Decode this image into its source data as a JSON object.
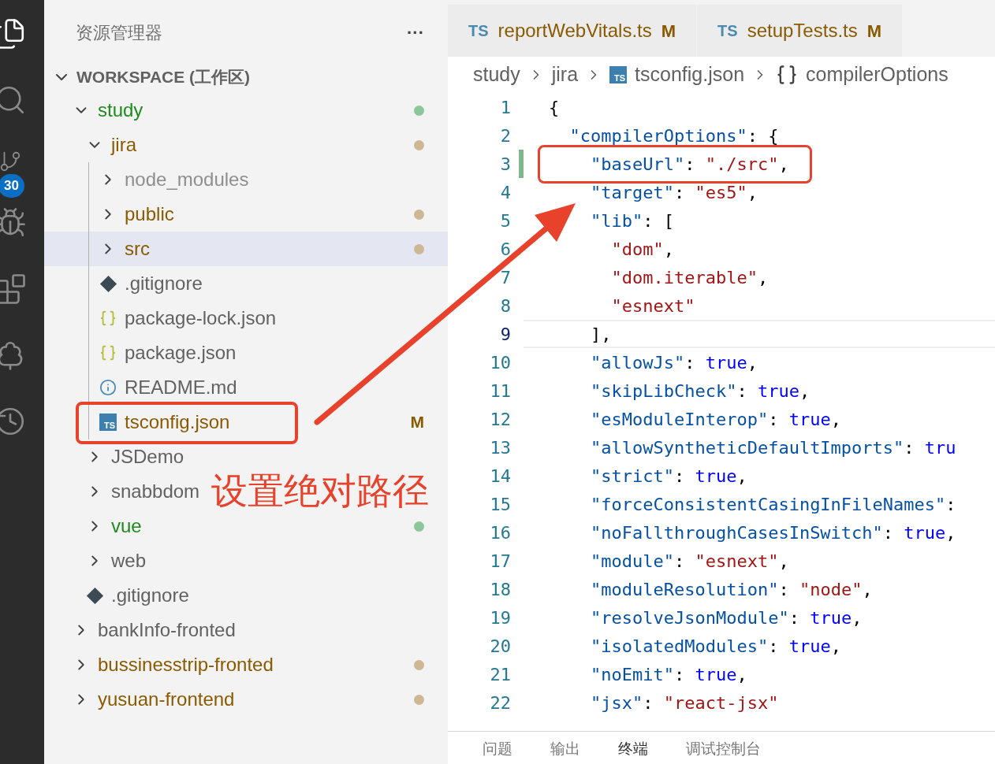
{
  "activity_bar": [
    {
      "kind": "files",
      "selected": true
    },
    {
      "kind": "search",
      "selected": false
    },
    {
      "kind": "source-control",
      "selected": false,
      "badge": "30"
    },
    {
      "kind": "run",
      "selected": false
    },
    {
      "kind": "extensions",
      "selected": false
    },
    {
      "kind": "tree",
      "selected": false
    },
    {
      "kind": "timeline",
      "selected": false
    }
  ],
  "sidebar": {
    "title": "资源管理器",
    "more": "···",
    "section": {
      "label": "WORKSPACE (工作区)",
      "expanded": true
    },
    "tree": [
      {
        "kind": "folder",
        "name": "study",
        "untracked": true,
        "ignored": false,
        "color": "#8cc69a",
        "expanded": true,
        "selected": false,
        "children": [
          {
            "kind": "folder",
            "name": "jira",
            "untracked": false,
            "ignored": false,
            "color": "#cdb893",
            "expanded": true,
            "selected": false,
            "children": [
              {
                "kind": "folder",
                "name": "node_modules",
                "untracked": false,
                "ignored": true,
                "expanded": false,
                "selected": false
              },
              {
                "kind": "folder",
                "name": "public",
                "untracked": false,
                "ignored": false,
                "color": "#cdb893",
                "expanded": false,
                "selected": false
              },
              {
                "kind": "folder",
                "name": "src",
                "untracked": false,
                "ignored": false,
                "color": "#cdb893",
                "expanded": false,
                "selected": true
              },
              {
                "kind": "git",
                "name": ".gitignore",
                "untracked": false,
                "ignored": false,
                "selected": false
              },
              {
                "kind": "json",
                "name": "package-lock.json",
                "untracked": false,
                "ignored": false,
                "selected": false
              },
              {
                "kind": "json",
                "name": "package.json",
                "untracked": false,
                "ignored": false,
                "selected": false
              },
              {
                "kind": "info",
                "name": "README.md",
                "untracked": false,
                "ignored": false,
                "selected": false
              },
              {
                "kind": "ts",
                "name": "tsconfig.json",
                "untracked": false,
                "ignored": false,
                "badge": "M",
                "icon_label": "TS",
                "selected": false
              }
            ]
          },
          {
            "kind": "folder",
            "name": "JSDemo",
            "untracked": false,
            "ignored": false,
            "expanded": false,
            "selected": false
          },
          {
            "kind": "folder",
            "name": "snabbdom",
            "untracked": false,
            "ignored": false,
            "expanded": false,
            "selected": false
          },
          {
            "kind": "folder",
            "name": "vue",
            "untracked": true,
            "ignored": false,
            "color": "#8cc69a",
            "expanded": false,
            "selected": false
          },
          {
            "kind": "folder",
            "name": "web",
            "untracked": false,
            "ignored": false,
            "expanded": false,
            "selected": false
          },
          {
            "kind": "git",
            "name": ".gitignore",
            "untracked": false,
            "ignored": false,
            "selected": false
          }
        ]
      },
      {
        "kind": "folder",
        "name": "bankInfo-fronted",
        "untracked": false,
        "ignored": false,
        "expanded": false,
        "selected": false
      },
      {
        "kind": "folder",
        "name": "bussinesstrip-fronted",
        "untracked": false,
        "ignored": false,
        "color": "#cdb893",
        "expanded": false,
        "selected": false
      },
      {
        "kind": "folder",
        "name": "yusuan-frontend",
        "untracked": false,
        "ignored": false,
        "color": "#cdb893",
        "expanded": false,
        "selected": false
      }
    ]
  },
  "editor": {
    "tabs": [
      {
        "icon_label": "TS",
        "label": "reportWebVitals.ts",
        "badge": "M",
        "selected": false
      },
      {
        "icon_label": "TS",
        "label": "setupTests.ts",
        "badge": "M",
        "selected": false
      }
    ],
    "breadcrumb": [
      {
        "kind": "folder",
        "label": "study"
      },
      {
        "kind": "folder",
        "label": "jira"
      },
      {
        "kind": "ts",
        "icon_label": "TS",
        "label": "tsconfig.json"
      },
      {
        "kind": "object",
        "label": "compilerOptions"
      }
    ],
    "lines": [
      {
        "number": "1",
        "current": false,
        "modified": false,
        "tokens": [
          {
            "kind": "punct",
            "text": "{"
          }
        ]
      },
      {
        "number": "2",
        "current": false,
        "modified": false,
        "tokens": [
          {
            "kind": "key",
            "text": "  \"compilerOptions\""
          },
          {
            "kind": "punct",
            "text": ": {"
          }
        ]
      },
      {
        "number": "3",
        "current": false,
        "modified": true,
        "tokens": [
          {
            "kind": "key",
            "text": "    \"baseUrl\""
          },
          {
            "kind": "punct",
            "text": ": "
          },
          {
            "kind": "string",
            "text": "\"./src\""
          },
          {
            "kind": "punct",
            "text": ","
          }
        ]
      },
      {
        "number": "4",
        "current": false,
        "modified": false,
        "tokens": [
          {
            "kind": "key",
            "text": "    \"target\""
          },
          {
            "kind": "punct",
            "text": ": "
          },
          {
            "kind": "string",
            "text": "\"es5\""
          },
          {
            "kind": "punct",
            "text": ","
          }
        ]
      },
      {
        "number": "5",
        "current": false,
        "modified": false,
        "tokens": [
          {
            "kind": "key",
            "text": "    \"lib\""
          },
          {
            "kind": "punct",
            "text": ": ["
          }
        ]
      },
      {
        "number": "6",
        "current": false,
        "modified": false,
        "tokens": [
          {
            "kind": "string",
            "text": "      \"dom\""
          },
          {
            "kind": "punct",
            "text": ","
          }
        ]
      },
      {
        "number": "7",
        "current": false,
        "modified": false,
        "tokens": [
          {
            "kind": "string",
            "text": "      \"dom.iterable\""
          },
          {
            "kind": "punct",
            "text": ","
          }
        ]
      },
      {
        "number": "8",
        "current": false,
        "modified": false,
        "tokens": [
          {
            "kind": "string",
            "text": "      \"esnext\""
          }
        ]
      },
      {
        "number": "9",
        "current": true,
        "modified": false,
        "tokens": [
          {
            "kind": "punct",
            "text": "    ],"
          }
        ]
      },
      {
        "number": "10",
        "current": false,
        "modified": false,
        "tokens": [
          {
            "kind": "key",
            "text": "    \"allowJs\""
          },
          {
            "kind": "punct",
            "text": ": "
          },
          {
            "kind": "keyword",
            "text": "true"
          },
          {
            "kind": "punct",
            "text": ","
          }
        ]
      },
      {
        "number": "11",
        "current": false,
        "modified": false,
        "tokens": [
          {
            "kind": "key",
            "text": "    \"skipLibCheck\""
          },
          {
            "kind": "punct",
            "text": ": "
          },
          {
            "kind": "keyword",
            "text": "true"
          },
          {
            "kind": "punct",
            "text": ","
          }
        ]
      },
      {
        "number": "12",
        "current": false,
        "modified": false,
        "tokens": [
          {
            "kind": "key",
            "text": "    \"esModuleInterop\""
          },
          {
            "kind": "punct",
            "text": ": "
          },
          {
            "kind": "keyword",
            "text": "true"
          },
          {
            "kind": "punct",
            "text": ","
          }
        ]
      },
      {
        "number": "13",
        "current": false,
        "modified": false,
        "tokens": [
          {
            "kind": "key",
            "text": "    \"allowSyntheticDefaultImports\""
          },
          {
            "kind": "punct",
            "text": ": "
          },
          {
            "kind": "keyword",
            "text": "tru"
          }
        ]
      },
      {
        "number": "14",
        "current": false,
        "modified": false,
        "tokens": [
          {
            "kind": "key",
            "text": "    \"strict\""
          },
          {
            "kind": "punct",
            "text": ": "
          },
          {
            "kind": "keyword",
            "text": "true"
          },
          {
            "kind": "punct",
            "text": ","
          }
        ]
      },
      {
        "number": "15",
        "current": false,
        "modified": false,
        "tokens": [
          {
            "kind": "key",
            "text": "    \"forceConsistentCasingInFileNames\""
          },
          {
            "kind": "punct",
            "text": ":"
          }
        ]
      },
      {
        "number": "16",
        "current": false,
        "modified": false,
        "tokens": [
          {
            "kind": "key",
            "text": "    \"noFallthroughCasesInSwitch\""
          },
          {
            "kind": "punct",
            "text": ": "
          },
          {
            "kind": "keyword",
            "text": "true"
          },
          {
            "kind": "punct",
            "text": ","
          }
        ]
      },
      {
        "number": "17",
        "current": false,
        "modified": false,
        "tokens": [
          {
            "kind": "key",
            "text": "    \"module\""
          },
          {
            "kind": "punct",
            "text": ": "
          },
          {
            "kind": "string",
            "text": "\"esnext\""
          },
          {
            "kind": "punct",
            "text": ","
          }
        ]
      },
      {
        "number": "18",
        "current": false,
        "modified": false,
        "tokens": [
          {
            "kind": "key",
            "text": "    \"moduleResolution\""
          },
          {
            "kind": "punct",
            "text": ": "
          },
          {
            "kind": "string",
            "text": "\"node\""
          },
          {
            "kind": "punct",
            "text": ","
          }
        ]
      },
      {
        "number": "19",
        "current": false,
        "modified": false,
        "tokens": [
          {
            "kind": "key",
            "text": "    \"resolveJsonModule\""
          },
          {
            "kind": "punct",
            "text": ": "
          },
          {
            "kind": "keyword",
            "text": "true"
          },
          {
            "kind": "punct",
            "text": ","
          }
        ]
      },
      {
        "number": "20",
        "current": false,
        "modified": false,
        "tokens": [
          {
            "kind": "key",
            "text": "    \"isolatedModules\""
          },
          {
            "kind": "punct",
            "text": ": "
          },
          {
            "kind": "keyword",
            "text": "true"
          },
          {
            "kind": "punct",
            "text": ","
          }
        ]
      },
      {
        "number": "21",
        "current": false,
        "modified": false,
        "tokens": [
          {
            "kind": "key",
            "text": "    \"noEmit\""
          },
          {
            "kind": "punct",
            "text": ": "
          },
          {
            "kind": "keyword",
            "text": "true"
          },
          {
            "kind": "punct",
            "text": ","
          }
        ]
      },
      {
        "number": "22",
        "current": false,
        "modified": false,
        "tokens": [
          {
            "kind": "key",
            "text": "    \"jsx\""
          },
          {
            "kind": "punct",
            "text": ": "
          },
          {
            "kind": "string",
            "text": "\"react-jsx\""
          }
        ]
      }
    ]
  },
  "panel": {
    "tabs": [
      {
        "label": "问题",
        "selected": false
      },
      {
        "label": "输出",
        "selected": false
      },
      {
        "label": "终端",
        "selected": true
      },
      {
        "label": "调试控制台",
        "selected": false
      }
    ]
  },
  "annotation": {
    "text": "设置绝对路径"
  }
}
